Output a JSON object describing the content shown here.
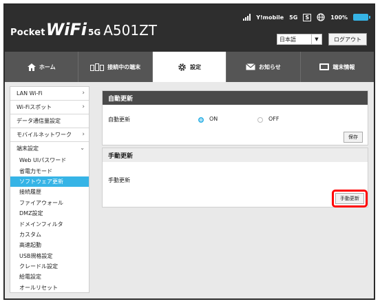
{
  "header": {
    "brand_pocket": "Pocket",
    "brand_wifi": "WiFi",
    "brand_5g": "5G",
    "model": "A501ZT",
    "carrier": "Y!mobile",
    "network": "5G",
    "sim": "S",
    "battery": "100%",
    "language": "日本語",
    "logout": "ログアウト"
  },
  "nav": {
    "tabs": [
      {
        "label": "ホーム",
        "icon": "home-icon"
      },
      {
        "label": "接続中の端末",
        "icon": "devices-icon"
      },
      {
        "label": "設定",
        "icon": "gear-icon"
      },
      {
        "label": "お知らせ",
        "icon": "envelope-icon"
      },
      {
        "label": "端末情報",
        "icon": "device-info-icon"
      }
    ],
    "active": "設定"
  },
  "sidebar": {
    "items": [
      {
        "label": "LAN Wi-Fi"
      },
      {
        "label": "Wi-Fiスポット"
      },
      {
        "label": "データ通信量設定"
      },
      {
        "label": "モバイルネットワーク"
      }
    ],
    "group": {
      "label": "端末設定",
      "subitems": [
        {
          "label": "Web UIパスワード"
        },
        {
          "label": "省電力モード"
        },
        {
          "label": "ソフトウェア更新"
        },
        {
          "label": "接続履歴"
        },
        {
          "label": "ファイアウォール"
        },
        {
          "label": "DMZ設定"
        },
        {
          "label": "ドメインフィルタ"
        },
        {
          "label": "カスタム"
        },
        {
          "label": "高速起動"
        },
        {
          "label": "USB規格設定"
        },
        {
          "label": "クレードル設定"
        },
        {
          "label": "給電設定"
        },
        {
          "label": "オールリセット"
        }
      ],
      "active": "ソフトウェア更新"
    }
  },
  "auto_update": {
    "title": "自動更新",
    "row_label": "自動更新",
    "on_label": "ON",
    "off_label": "OFF",
    "selected": "ON",
    "save": "保存"
  },
  "manual_update": {
    "title": "手動更新",
    "row_label": "手動更新",
    "button": "手動更新"
  },
  "colors": {
    "accent": "#36b4e6",
    "header_bg": "#2e2e2e",
    "nav_bg": "#555555",
    "highlight": "#ff0000"
  }
}
